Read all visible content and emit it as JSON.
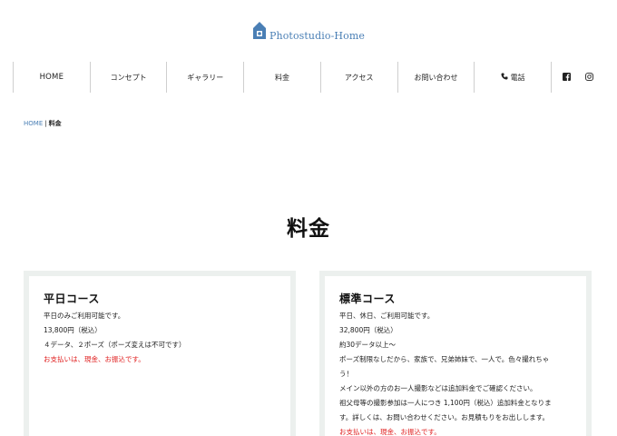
{
  "logo": {
    "text": "Photostudio-Home",
    "icon": "house-icon",
    "color": "#4a7fb5"
  },
  "nav": {
    "items": [
      "HOME",
      "コンセプト",
      "ギャラリー",
      "料金",
      "アクセス",
      "お問い合わせ"
    ],
    "phone_label": "電話",
    "icons": [
      "phone-icon",
      "facebook-icon",
      "instagram-icon"
    ]
  },
  "breadcrumb": {
    "home": "HOME",
    "separator": "|",
    "current": "料金"
  },
  "page": {
    "title": "料金"
  },
  "courses": [
    {
      "title": "平日コース",
      "lines": [
        "平日のみご利用可能です。",
        "13,800円（税込）",
        "４データ、２ポーズ（ポーズ変えは不可です）"
      ],
      "payment": "お支払いは、現金、お振込です。"
    },
    {
      "title": "標準コース",
      "lines": [
        "平日、休日、ご利用可能です。",
        "32,800円（税込）",
        "約30データ以上～",
        "ポーズ制限なしだから、家族で、兄弟姉妹で、一人で。色々撮れちゃ",
        "う！",
        "メイン以外の方のお一人撮影などは追加料金でご確認ください。",
        "祖父母等の撮影参加は一人につき 1,100円（税込）追加料金となりま",
        "す。詳しくは、お問い合わせください。お見積もりをお出しします。"
      ],
      "payment": "お支払いは、現金、お振込です。"
    }
  ],
  "colors": {
    "accent": "#4a7fb5",
    "alert": "#e02020",
    "card_border": "#ecf0ee"
  }
}
